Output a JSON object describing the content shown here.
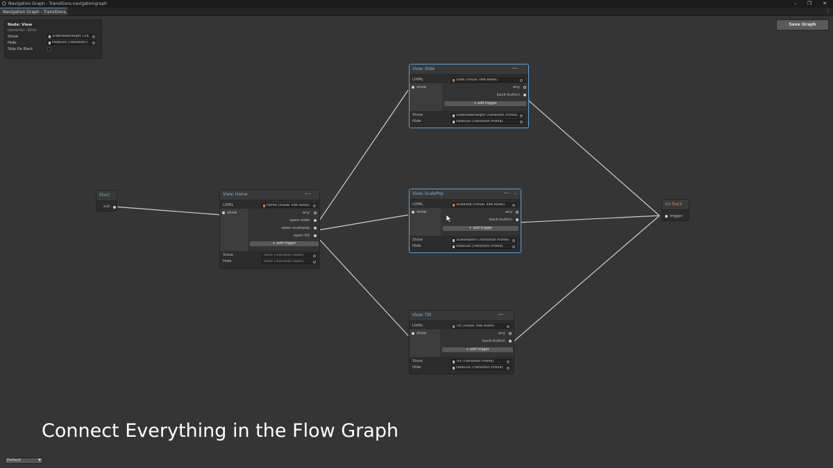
{
  "window": {
    "title": "Navigation Graph - Transitions.navigationgraph",
    "tab_label": "Navigation Graph - Transitions.na..."
  },
  "inspector": {
    "node_title": "Node: View",
    "identifier": "Identifier: Slide",
    "show_label": "Show",
    "show_value": "SlideFadeInRight (Tra",
    "hide_label": "Hide",
    "hide_value": "FadeOut (Transition I",
    "skip_label": "Skip On Back"
  },
  "toolbar": {
    "save_label": "Save Graph"
  },
  "nodes": {
    "start": {
      "title": "Start",
      "port": "out"
    },
    "home": {
      "title": "View: Home",
      "uxml_label": "UXML",
      "uxml_value": "Home (Visual Tree Asset)",
      "show_port": "show",
      "outputs": [
        "any",
        "open-slide",
        "open-scalepop",
        "open-tilt"
      ],
      "add_trigger": "+ add trigger",
      "show_label": "Show",
      "show_value": "None (Transition Asset)",
      "hide_label": "Hide",
      "hide_value": "None (Transition Asset)"
    },
    "slide": {
      "title": "View: Slide",
      "uxml_label": "UXML",
      "uxml_value": "Slide (Visual Tree Asset)",
      "show_port": "show",
      "outputs": [
        "any",
        "back-button"
      ],
      "add_trigger": "+ add trigger",
      "show_label": "Show",
      "show_value": "SlideFadeInRight (Transition Profile)",
      "hide_label": "Hide",
      "hide_value": "FadeOut (Transition Profile)"
    },
    "scalepop": {
      "title": "View: ScalePop",
      "uxml_label": "UXML",
      "uxml_value": "ScalePop (Visual Tree Asset)",
      "show_port": "show",
      "outputs": [
        "any",
        "back-button"
      ],
      "add_trigger": "+ add trigger",
      "show_label": "Show",
      "show_value": "ScaleFadeIn (Transition Profile)",
      "hide_label": "Hide",
      "hide_value": "FadeOut (Transition Profile)"
    },
    "tilt": {
      "title": "View: Tilt",
      "uxml_label": "UXML",
      "uxml_value": "Tilt (Visual Tree Asset)",
      "show_port": "show",
      "outputs": [
        "any",
        "back-button"
      ],
      "add_trigger": "+ add trigger",
      "show_label": "Show",
      "show_value": "Tilt (Transition Profile)",
      "hide_label": "Hide",
      "hide_value": "FadeOut (Transition Profile)"
    },
    "goback": {
      "title": "Go Back",
      "port": "trigger"
    }
  },
  "caption": "Connect Everything in the Flow Graph",
  "layout_dropdown": "Default",
  "colors": {
    "accent": "#5aa6e0",
    "start_title": "#58b9a2",
    "goback_title": "#c98a5a",
    "view_title": "#7fb3d8"
  }
}
